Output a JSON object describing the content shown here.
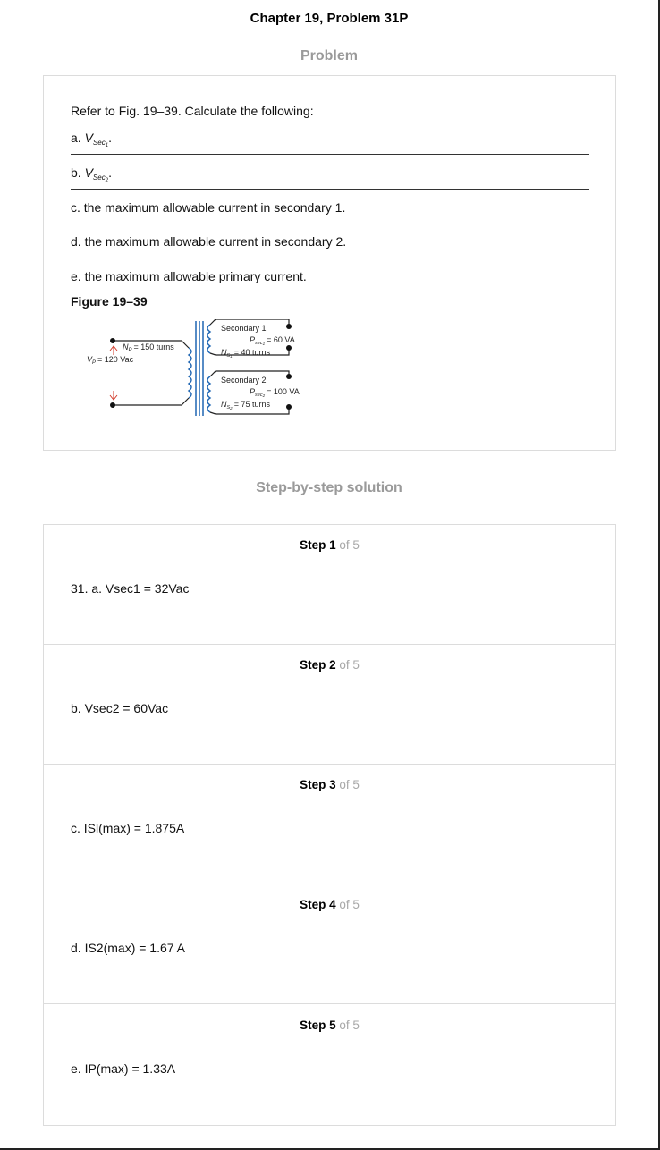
{
  "header": {
    "title": "Chapter 19, Problem 31P"
  },
  "problem": {
    "heading": "Problem",
    "intro": "Refer to Fig. 19–39. Calculate the following:",
    "items": [
      {
        "prefix": "a.",
        "var": "V",
        "sub": "Sec",
        "sub2": "1",
        "suffix": "."
      },
      {
        "prefix": "b.",
        "var": "V",
        "sub": "Sec",
        "sub2": "2",
        "suffix": "."
      },
      {
        "text": "c. the maximum allowable current in secondary 1."
      },
      {
        "text": "d. the maximum allowable current in secondary 2."
      },
      {
        "text": "e. the maximum allowable primary current."
      }
    ],
    "figure_title": "Figure 19–39",
    "figure": {
      "sec1_label": "Secondary 1",
      "sec1_power": "= 60 VA",
      "sec1_turns": "= 40 turns",
      "sec2_label": "Secondary 2",
      "sec2_power": "= 100 VA",
      "sec2_turns": "= 75 turns",
      "primary_turns": "= 150 turns",
      "primary_voltage": "= 120 Vac",
      "p_var": "P",
      "n_var": "N",
      "v_var": "V",
      "sub_sec1": "sec",
      "sub_sec1_n": "1",
      "sub_sec2": "sec",
      "sub_sec2_n": "2",
      "sub_s1": "S",
      "sub_s1_n": "1",
      "sub_s2": "S",
      "sub_s2_n": "2",
      "sub_p": "P",
      "coil_color": "#1f66b3",
      "arrow_color": "#d23a2a"
    }
  },
  "solution": {
    "heading": "Step-by-step solution",
    "of_label": "of 5",
    "steps": [
      {
        "label": "Step 1",
        "text": "31. a. Vsec1 = 32Vac"
      },
      {
        "label": "Step 2",
        "text": "b. Vsec2 = 60Vac"
      },
      {
        "label": "Step 3",
        "text": "c. ISl(max) = 1.875A"
      },
      {
        "label": "Step 4",
        "text": "d. IS2(max) = 1.67 A"
      },
      {
        "label": "Step 5",
        "text": "e. IP(max) = 1.33A"
      }
    ]
  }
}
